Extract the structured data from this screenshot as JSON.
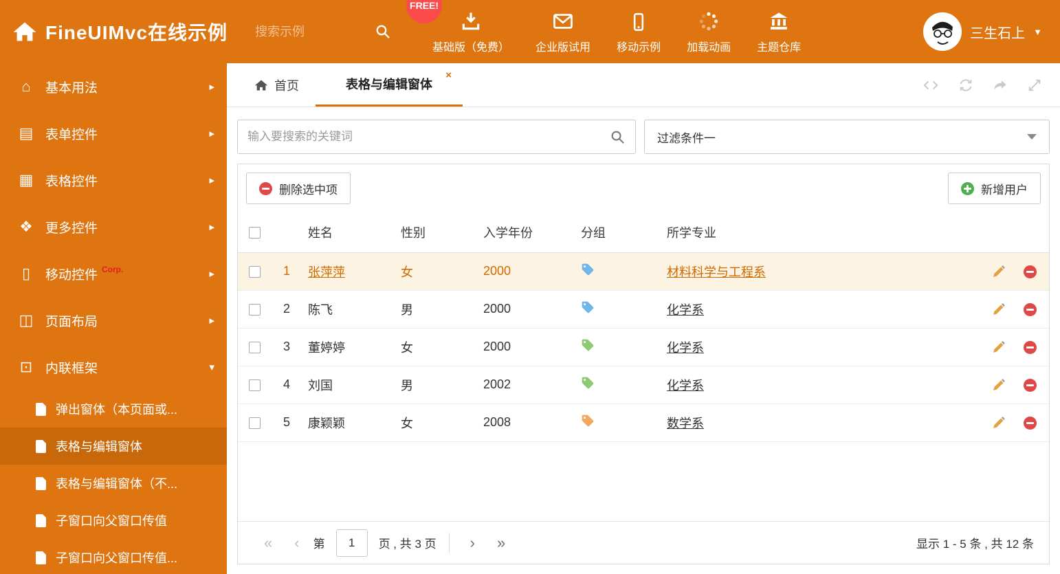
{
  "colors": {
    "accent": "#df7510",
    "accent_dark": "#c8680b",
    "link_orange": "#cf6a00",
    "selected_row_bg": "#fdf3e2",
    "free_badge_bg": "#fb4b4b",
    "tag_blue": "#6fb7e9",
    "tag_green": "#8fc973",
    "tag_orange": "#f0a95e"
  },
  "header": {
    "title": "FineUIMvc在线示例",
    "search_placeholder": "搜索示例",
    "free_badge": "FREE!",
    "nav": [
      {
        "label": "基础版（免费）",
        "icon": "download-icon"
      },
      {
        "label": "企业版试用",
        "icon": "envelope-icon"
      },
      {
        "label": "移动示例",
        "icon": "mobile-icon"
      },
      {
        "label": "加载动画",
        "icon": "spinner-icon"
      },
      {
        "label": "主题仓库",
        "icon": "bank-icon"
      }
    ],
    "user_name": "三生石上"
  },
  "sidebar": {
    "items": [
      {
        "label": "基本用法",
        "icon": "home-icon"
      },
      {
        "label": "表单控件",
        "icon": "form-icon"
      },
      {
        "label": "表格控件",
        "icon": "table-icon"
      },
      {
        "label": "更多控件",
        "icon": "more-icon"
      },
      {
        "label": "移动控件",
        "icon": "mobile-icon",
        "badge": "Corp."
      },
      {
        "label": "页面布局",
        "icon": "layout-icon"
      },
      {
        "label": "内联框架",
        "icon": "iframe-icon",
        "expanded": true
      }
    ],
    "subitems": [
      {
        "label": "弹出窗体（本页面或..."
      },
      {
        "label": "表格与编辑窗体",
        "active": true
      },
      {
        "label": "表格与编辑窗体（不..."
      },
      {
        "label": "子窗口向父窗口传值"
      },
      {
        "label": "子窗口向父窗口传值..."
      }
    ]
  },
  "tabbar": {
    "home_label": "首页",
    "active_label": "表格与编辑窗体",
    "close_glyph": "×"
  },
  "filter": {
    "search_placeholder": "输入要搜索的关键词",
    "dropdown_value": "过滤条件一"
  },
  "toolbar": {
    "delete_label": "删除选中项",
    "add_label": "新增用户"
  },
  "table": {
    "columns": [
      "姓名",
      "性别",
      "入学年份",
      "分组",
      "所学专业"
    ],
    "rows": [
      {
        "num": "1",
        "name": "张萍萍",
        "gender": "女",
        "year": "2000",
        "tag_color": "#6fb7e9",
        "major": "材料科学与工程系",
        "selected": true
      },
      {
        "num": "2",
        "name": "陈飞",
        "gender": "男",
        "year": "2000",
        "tag_color": "#6fb7e9",
        "major": "化学系"
      },
      {
        "num": "3",
        "name": "董婷婷",
        "gender": "女",
        "year": "2000",
        "tag_color": "#8fc973",
        "major": "化学系"
      },
      {
        "num": "4",
        "name": "刘国",
        "gender": "男",
        "year": "2002",
        "tag_color": "#8fc973",
        "major": "化学系"
      },
      {
        "num": "5",
        "name": "康颖颖",
        "gender": "女",
        "year": "2008",
        "tag_color": "#f0a95e",
        "major": "数学系"
      }
    ]
  },
  "pagination": {
    "first_glyph": "«",
    "prev_glyph": "‹",
    "next_glyph": "›",
    "last_glyph": "»",
    "prefix": "第",
    "page": "1",
    "suffix": "页 , 共 3 页",
    "summary": "显示 1 - 5 条 , 共 12 条"
  }
}
